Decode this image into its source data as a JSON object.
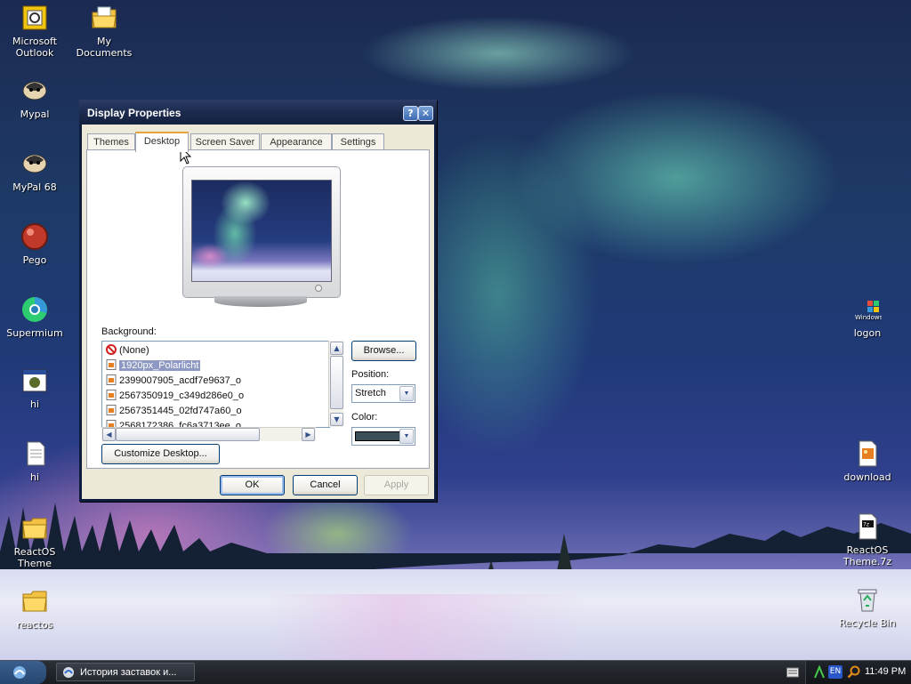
{
  "desktop": {
    "icons": [
      {
        "label": "Microsoft\nOutlook",
        "icon": "outlook-icon"
      },
      {
        "label": "My Documents",
        "icon": "folder-documents-icon"
      },
      {
        "label": "Mypal",
        "icon": "mypal-browser-icon"
      },
      {
        "label": "MyPal 68",
        "icon": "mypal-browser-icon"
      },
      {
        "label": "Pego",
        "icon": "red-ball-icon"
      },
      {
        "label": "Supermium",
        "icon": "supermium-browser-icon"
      },
      {
        "label": "hi",
        "icon": "application-window-icon"
      },
      {
        "label": "hi",
        "icon": "text-document-icon"
      },
      {
        "label": "ReactOS\nTheme",
        "icon": "folder-icon"
      },
      {
        "label": "reactos",
        "icon": "folder-icon"
      },
      {
        "label": "logon",
        "icon": "windows-logo-icon"
      },
      {
        "label": "download",
        "icon": "image-file-icon"
      },
      {
        "label": "ReactOS\nTheme.7z",
        "icon": "archive-file-icon"
      },
      {
        "label": "Recycle Bin",
        "icon": "recycle-bin-icon"
      }
    ]
  },
  "window": {
    "title": "Display Properties",
    "help_label": "?",
    "close_label": "✕",
    "tabs": [
      "Themes",
      "Desktop",
      "Screen Saver",
      "Appearance",
      "Settings"
    ],
    "active_tab": "Desktop",
    "background_label": "Background:",
    "background_items": [
      {
        "label": "(None)",
        "icon": "none-icon"
      },
      {
        "label": "1920px_Polarlicht",
        "icon": "image-file-icon",
        "selected": true
      },
      {
        "label": "2399007905_acdf7e9637_o",
        "icon": "image-file-icon"
      },
      {
        "label": "2567350919_c349d286e0_o",
        "icon": "image-file-icon"
      },
      {
        "label": "2567351445_02fd747a60_o",
        "icon": "image-file-icon"
      },
      {
        "label": "2568172386_fc6a3713ee_o",
        "icon": "image-file-icon"
      }
    ],
    "browse_label": "Browse...",
    "position_label": "Position:",
    "position_value": "Stretch",
    "color_label": "Color:",
    "color_value": "#3a4e58",
    "customize_label": "Customize Desktop...",
    "ok_label": "OK",
    "cancel_label": "Cancel",
    "apply_label": "Apply"
  },
  "taskbar": {
    "task_label": "История заставок и...",
    "lang": "EN",
    "clock": "11:49 PM"
  },
  "colors": {
    "accent": "#e9a33d",
    "selection": "#8d99c2",
    "taskbar": "#1d2026"
  }
}
